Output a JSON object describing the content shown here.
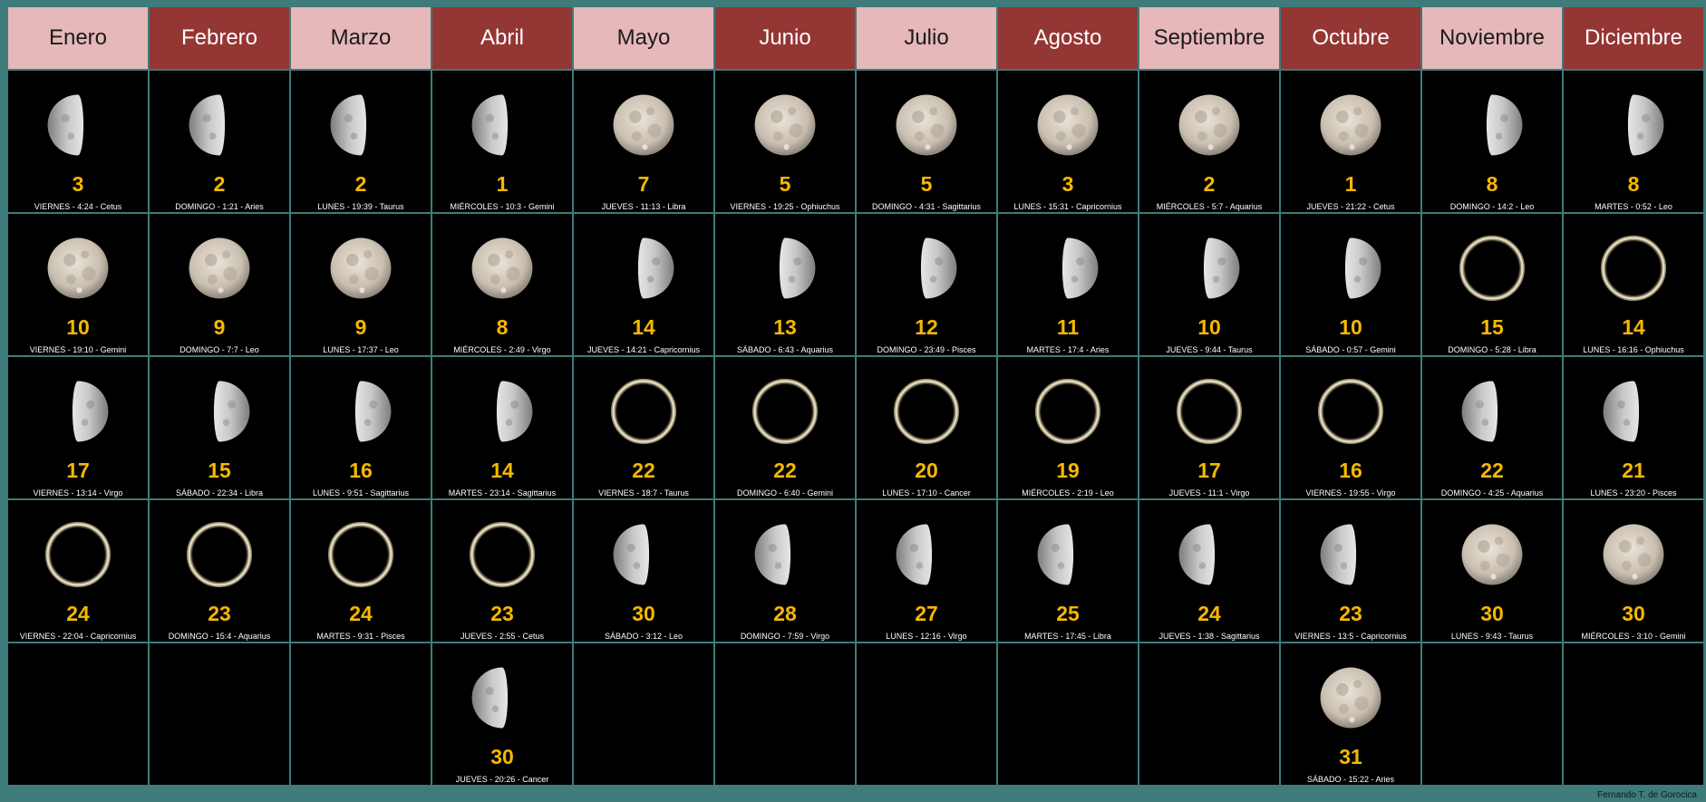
{
  "colors": {
    "page_bg": "#3f7b7b",
    "header_light": "#e6b8b9",
    "header_dark": "#943634",
    "day_number": "#f6b800",
    "cell_bg": "#000000"
  },
  "months": [
    {
      "name": "Enero",
      "style": "light",
      "events": [
        {
          "phase": "waning",
          "day": "3",
          "info": "VIERNES  - 4:24 - Cetus"
        },
        {
          "phase": "full",
          "day": "10",
          "info": "VIERNES  - 19:10 - Gemini"
        },
        {
          "phase": "waxing",
          "day": "17",
          "info": "VIERNES  - 13:14 - Virgo"
        },
        {
          "phase": "new",
          "day": "24",
          "info": "VIERNES  - 22:04 - Capricornius"
        }
      ]
    },
    {
      "name": "Febrero",
      "style": "dark",
      "events": [
        {
          "phase": "waning",
          "day": "2",
          "info": "DOMINGO  - 1:21 - Aries"
        },
        {
          "phase": "full",
          "day": "9",
          "info": "DOMINGO  - 7:7 - Leo"
        },
        {
          "phase": "waxing",
          "day": "15",
          "info": "SÁBADO  - 22:34 - Libra"
        },
        {
          "phase": "new",
          "day": "23",
          "info": "DOMINGO  - 15:4 - Aquarius"
        }
      ]
    },
    {
      "name": "Marzo",
      "style": "light",
      "events": [
        {
          "phase": "waning",
          "day": "2",
          "info": "LUNES - 19:39 - Taurus"
        },
        {
          "phase": "full",
          "day": "9",
          "info": "LUNES  - 17:37 - Leo"
        },
        {
          "phase": "waxing",
          "day": "16",
          "info": "LUNES  - 9:51 - Sagittarius"
        },
        {
          "phase": "new",
          "day": "24",
          "info": "MARTES  - 9:31 - Pisces"
        }
      ]
    },
    {
      "name": "Abril",
      "style": "dark",
      "events": [
        {
          "phase": "waning",
          "day": "1",
          "info": "MIÉRCOLES  - 10:3 - Gemini"
        },
        {
          "phase": "full",
          "day": "8",
          "info": "MIÉRCOLES  - 2:49 - Virgo"
        },
        {
          "phase": "waxing",
          "day": "14",
          "info": "MARTES  - 23:14 - Sagittarius"
        },
        {
          "phase": "new",
          "day": "23",
          "info": "JUEVES - 2:55 - Cetus"
        },
        {
          "phase": "waning",
          "day": "30",
          "info": "JUEVES - 20:26 - Cancer"
        }
      ]
    },
    {
      "name": "Mayo",
      "style": "light",
      "events": [
        {
          "phase": "full",
          "day": "7",
          "info": "JUEVES - 11:13 - Libra"
        },
        {
          "phase": "waxing",
          "day": "14",
          "info": "JUEVES - 14:21 - Capricornius"
        },
        {
          "phase": "new",
          "day": "22",
          "info": "VIERNES  - 18:7 - Taurus"
        },
        {
          "phase": "waning",
          "day": "30",
          "info": "SÁBADO  - 3:12 - Leo"
        }
      ]
    },
    {
      "name": "Junio",
      "style": "dark",
      "events": [
        {
          "phase": "full",
          "day": "5",
          "info": "VIERNES  - 19:25 - Ophiuchus"
        },
        {
          "phase": "waxing",
          "day": "13",
          "info": "SÁBADO  - 6:43 - Aquarius"
        },
        {
          "phase": "new",
          "day": "22",
          "info": "DOMINGO  - 6:40 - Gemini"
        },
        {
          "phase": "waning",
          "day": "28",
          "info": "DOMINGO  - 7:59 - Virgo"
        }
      ]
    },
    {
      "name": "Julio",
      "style": "light",
      "events": [
        {
          "phase": "full",
          "day": "5",
          "info": "DOMINGO - 4:31 - Sagittarius"
        },
        {
          "phase": "waxing",
          "day": "12",
          "info": "DOMINGO - 23:49 - Pisces"
        },
        {
          "phase": "new",
          "day": "20",
          "info": "LUNES - 17:10 - Cancer"
        },
        {
          "phase": "waning",
          "day": "27",
          "info": "LUNES - 12:16 - Virgo"
        }
      ]
    },
    {
      "name": "Agosto",
      "style": "dark",
      "events": [
        {
          "phase": "full",
          "day": "3",
          "info": "LUNES - 15:31 - Capricornius"
        },
        {
          "phase": "waxing",
          "day": "11",
          "info": "MARTES - 17:4 - Aries"
        },
        {
          "phase": "new",
          "day": "19",
          "info": "MIÉRCOLES - 2:19 - Leo"
        },
        {
          "phase": "waning",
          "day": "25",
          "info": "MARTES - 17:45 - Libra"
        }
      ]
    },
    {
      "name": "Septiembre",
      "style": "light",
      "events": [
        {
          "phase": "full",
          "day": "2",
          "info": "MIÉRCOLES - 5:7 - Aquarius"
        },
        {
          "phase": "waxing",
          "day": "10",
          "info": "JUEVES - 9:44 - Taurus"
        },
        {
          "phase": "new",
          "day": "17",
          "info": "JUEVES - 11:1 - Virgo"
        },
        {
          "phase": "waning",
          "day": "24",
          "info": "JUEVES - 1:38 - Sagittarius"
        }
      ]
    },
    {
      "name": "Octubre",
      "style": "dark",
      "events": [
        {
          "phase": "full",
          "day": "1",
          "info": "JUEVES - 21:22 - Cetus"
        },
        {
          "phase": "waxing",
          "day": "10",
          "info": "SÁBADO - 0:57 - Gemini"
        },
        {
          "phase": "new",
          "day": "16",
          "info": "VIERNES - 19:55 - Virgo"
        },
        {
          "phase": "waning",
          "day": "23",
          "info": "VIERNES - 13:5 - Capricornius"
        },
        {
          "phase": "full",
          "day": "31",
          "info": "SÁBADO - 15:22 - Aries"
        }
      ]
    },
    {
      "name": "Noviembre",
      "style": "light",
      "events": [
        {
          "phase": "waxing",
          "day": "8",
          "info": "DOMINGO - 14:2 - Leo"
        },
        {
          "phase": "new",
          "day": "15",
          "info": "DOMINGO - 5:28 - Libra"
        },
        {
          "phase": "waning",
          "day": "22",
          "info": "DOMINGO - 4:25 - Aquarius"
        },
        {
          "phase": "full",
          "day": "30",
          "info": "LUNES - 9:43 - Taurus"
        }
      ]
    },
    {
      "name": "Diciembre",
      "style": "dark",
      "events": [
        {
          "phase": "waxing",
          "day": "8",
          "info": "MARTES - 0:52 - Leo"
        },
        {
          "phase": "new",
          "day": "14",
          "info": "LUNES - 16:16 - Ophiuchus"
        },
        {
          "phase": "waning",
          "day": "21",
          "info": "LUNES - 23:20 - Pisces"
        },
        {
          "phase": "full",
          "day": "30",
          "info": "MIÉRCOLES - 3:10 - Gemini"
        }
      ]
    }
  ],
  "credit": "Fernando T. de Gorocica"
}
